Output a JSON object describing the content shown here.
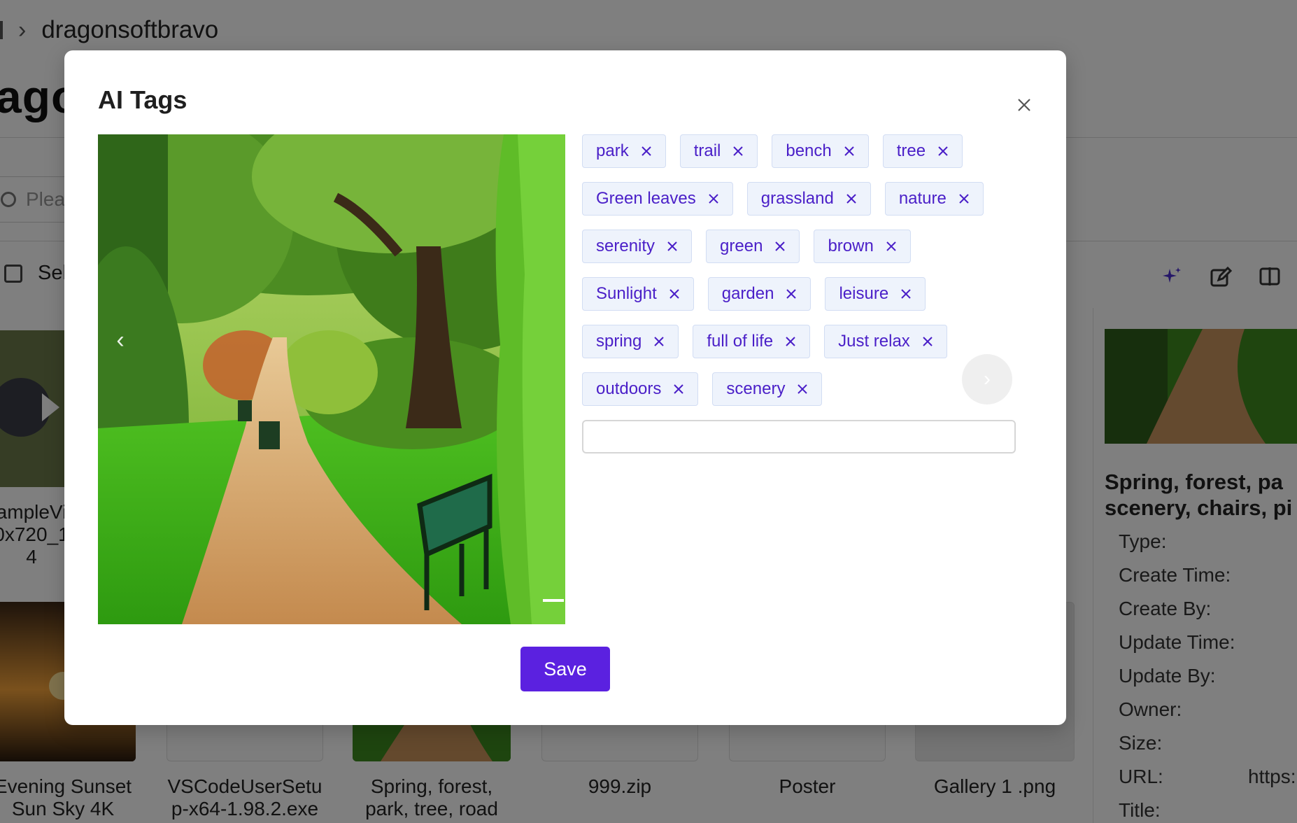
{
  "background": {
    "breadcrumb": {
      "current": "dragonsoftbravo"
    },
    "page_title": "agon",
    "search_placeholder": "Plea",
    "select_label": "Sel",
    "files": [
      {
        "line1": "ampleVi",
        "line2": "0x720_1",
        "line3": "4"
      },
      {
        "line1": "Evening Sunset",
        "line2": "Sun Sky 4K"
      },
      {
        "line1": "VSCodeUserSetu",
        "line2": "p-x64-1.98.2.exe"
      },
      {
        "line1": "Spring, forest,",
        "line2": "park, tree, road"
      },
      {
        "line1": "999.zip"
      },
      {
        "line1": "Poster"
      },
      {
        "line1": "Gallery 1 .png"
      }
    ],
    "detail_panel": {
      "title_line1": "Spring, forest, pa",
      "title_line2": "scenery, chairs, pi",
      "fields": [
        "Type:",
        "Create Time:",
        "Create By:",
        "Update Time:",
        "Update By:",
        "Owner:",
        "Size:",
        "URL:",
        "Title:"
      ],
      "url_value": "https:"
    }
  },
  "modal": {
    "title": "AI Tags",
    "tags": [
      [
        "park",
        "trail",
        "bench",
        "tree"
      ],
      [
        "Green leaves",
        "grassland",
        "nature"
      ],
      [
        "serenity",
        "green",
        "brown"
      ],
      [
        "Sunlight",
        "garden",
        "leisure"
      ],
      [
        "spring",
        "full of life",
        "Just relax"
      ],
      [
        "outdoors",
        "scenery"
      ]
    ],
    "tag_input_value": "",
    "save_label": "Save",
    "carousel_prev_glyph": "‹",
    "carousel_next_glyph": "›"
  },
  "colors": {
    "accent": "#5b21e0",
    "tag_text": "#4a1fc8",
    "tag_bg": "#eef3fc",
    "tag_border": "#d2ddf3"
  }
}
